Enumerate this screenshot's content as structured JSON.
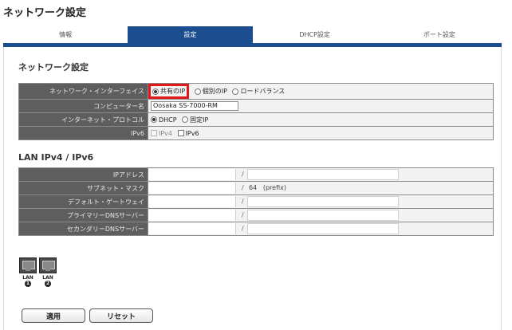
{
  "page": {
    "title": "ネットワーク設定"
  },
  "tabs": [
    {
      "label": "情報"
    },
    {
      "label": "設定"
    },
    {
      "label": "DHCP設定"
    },
    {
      "label": "ポート設定"
    }
  ],
  "network": {
    "section_title": "ネットワーク設定",
    "interface": {
      "label": "ネットワーク・インターフェイス",
      "options": [
        "共有のIP",
        "個別のIP",
        "ロードバランス"
      ],
      "selected": "共有のIP"
    },
    "computer_name": {
      "label": "コンピューター名",
      "value": "Oosaka SS-7000-RM"
    },
    "protocol": {
      "label": "インターネット・プロトコル",
      "options": [
        "DHCP",
        "固定IP"
      ],
      "selected": "DHCP"
    },
    "ipv6": {
      "label": "IPv6",
      "options": [
        "IPv4",
        "IPv6"
      ]
    }
  },
  "lan": {
    "section_title": "LAN IPv4 / IPv6",
    "rows": [
      {
        "label": "IPアドレス",
        "ipv6_value": "",
        "prefix": ""
      },
      {
        "label": "サブネット・マスク",
        "ipv6_value": "64",
        "prefix": "(prefix)"
      },
      {
        "label": "デフォルト・ゲートウェイ",
        "ipv6_value": "",
        "prefix": ""
      },
      {
        "label": "プライマリーDNSサーバー",
        "ipv6_value": "",
        "prefix": ""
      },
      {
        "label": "セカンダリーDNSサーバー",
        "ipv6_value": "",
        "prefix": ""
      }
    ],
    "slash": "/"
  },
  "ports": [
    {
      "label": "LAN",
      "number": "1"
    },
    {
      "label": "LAN",
      "number": "2"
    }
  ],
  "buttons": {
    "apply": "適用",
    "reset": "リセット"
  },
  "colors": {
    "accent": "#1c4e8f",
    "label_bg": "#5e5e5e",
    "highlight": "#e01818"
  }
}
